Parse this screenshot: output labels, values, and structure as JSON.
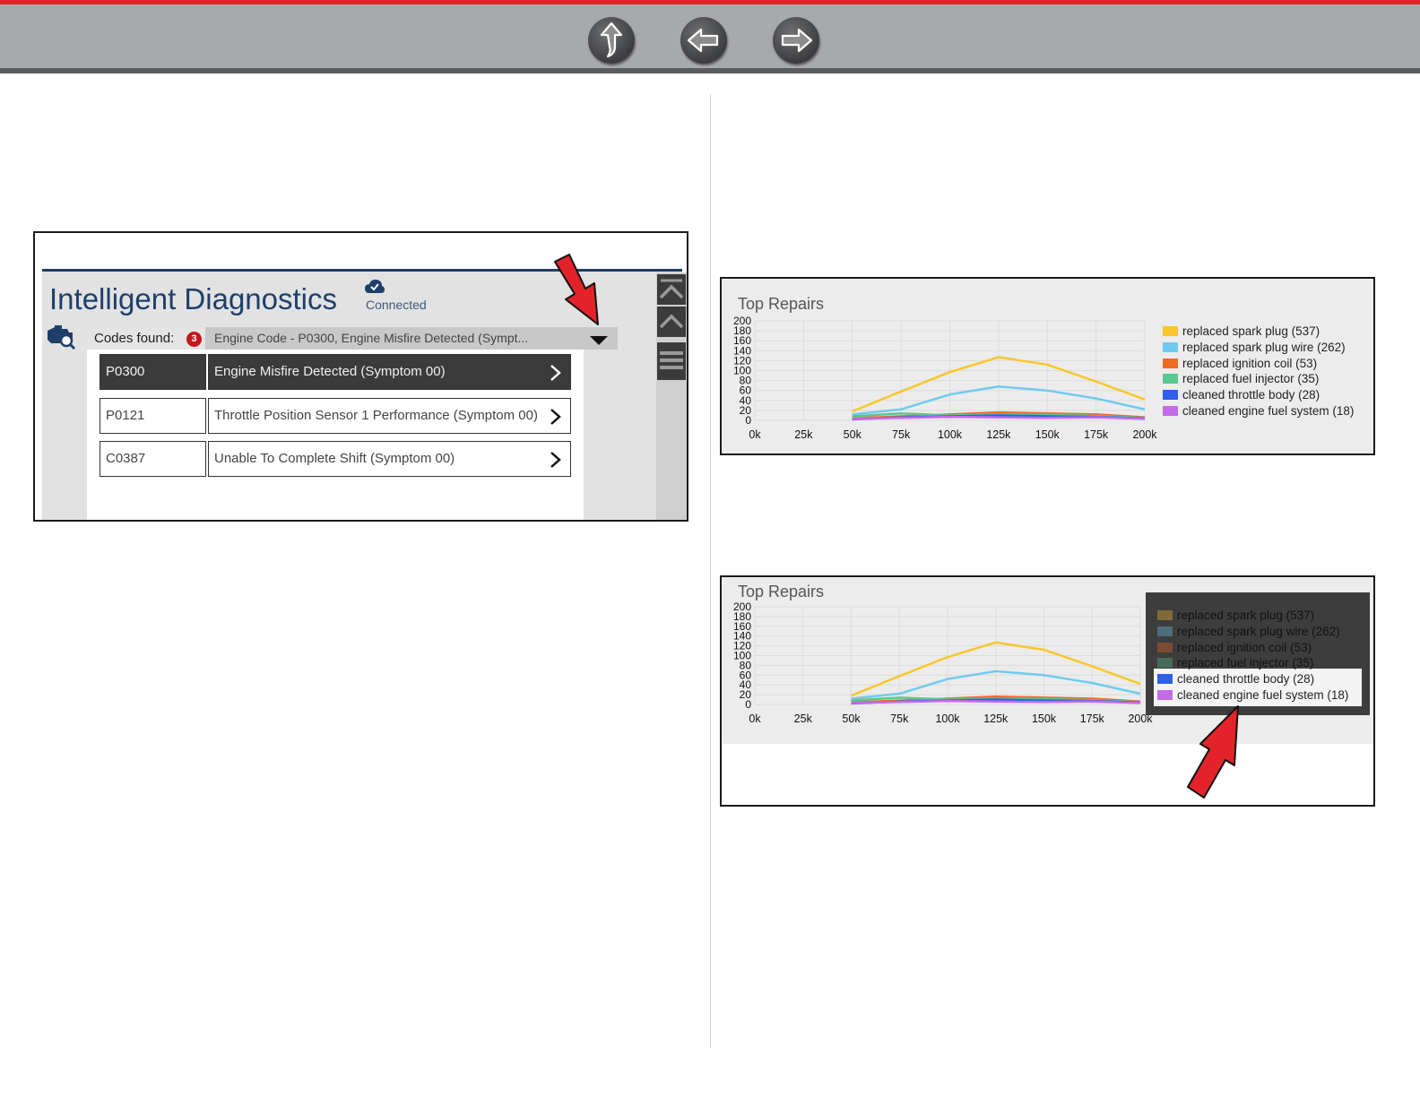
{
  "nav": {
    "buttons": [
      {
        "name": "up-arrow-icon",
        "label": "Up"
      },
      {
        "name": "back-arrow-icon",
        "label": "Back"
      },
      {
        "name": "forward-arrow-icon",
        "label": "Forward"
      }
    ],
    "accent_color": "#e2232a"
  },
  "diagnostics": {
    "title": "Intelligent Diagnostics",
    "status": "Connected",
    "codes_found_label": "Codes found:",
    "codes_found_count": "3",
    "selected_code_text": "Engine Code - P0300, Engine Misfire Detected (Sympt...",
    "codes": [
      {
        "code": "P0300",
        "description": "Engine Misfire Detected (Symptom 00)",
        "selected": true
      },
      {
        "code": "P0121",
        "description": "Throttle Position Sensor 1 Performance (Symptom 00)",
        "selected": false
      },
      {
        "code": "C0387",
        "description": "Unable To Complete Shift (Symptom 00)",
        "selected": false
      }
    ],
    "side_buttons": [
      "scroll-to-top-icon",
      "scroll-up-icon",
      "menu-icon"
    ]
  },
  "charts": {
    "top": {
      "highlighted_legend": []
    },
    "bottom": {
      "highlighted_legend": [
        "cleaned throttle body (28)",
        "cleaned engine fuel system (18)"
      ]
    }
  },
  "chart_data": [
    {
      "type": "line",
      "title": "Top Repairs",
      "x": [
        "0k",
        "25k",
        "50k",
        "75k",
        "100k",
        "125k",
        "150k",
        "175k",
        "200k"
      ],
      "x_values": [
        0,
        25,
        50,
        75,
        100,
        125,
        150,
        175,
        200
      ],
      "ylim": [
        0,
        200
      ],
      "yticks": [
        0,
        20,
        40,
        60,
        80,
        100,
        120,
        140,
        160,
        180,
        200
      ],
      "grid": true,
      "legend_position": "right",
      "series": [
        {
          "name": "replaced spark plug (537)",
          "color": "#f9c72a",
          "x": [
            50,
            75,
            100,
            125,
            150,
            175,
            200
          ],
          "values": [
            18,
            58,
            97,
            127,
            112,
            78,
            42
          ]
        },
        {
          "name": "replaced spark plug wire (262)",
          "color": "#6fcbef",
          "x": [
            50,
            75,
            100,
            125,
            150,
            175,
            200
          ],
          "values": [
            12,
            22,
            52,
            68,
            60,
            44,
            22
          ]
        },
        {
          "name": "replaced ignition coil (53)",
          "color": "#f06a23",
          "x": [
            50,
            75,
            100,
            125,
            150,
            175,
            200
          ],
          "values": [
            4,
            8,
            12,
            16,
            14,
            12,
            6
          ]
        },
        {
          "name": "replaced fuel injector (35)",
          "color": "#5ac78e",
          "x": [
            50,
            75,
            100,
            125,
            150,
            175,
            200
          ],
          "values": [
            8,
            14,
            10,
            12,
            11,
            9,
            5
          ]
        },
        {
          "name": "cleaned throttle body (28)",
          "color": "#2f5ee8",
          "x": [
            50,
            75,
            100,
            125,
            150,
            175,
            200
          ],
          "values": [
            2,
            6,
            8,
            10,
            8,
            7,
            4
          ]
        },
        {
          "name": "cleaned engine fuel system (18)",
          "color": "#c56be8",
          "x": [
            50,
            75,
            100,
            125,
            150,
            175,
            200
          ],
          "values": [
            3,
            5,
            7,
            6,
            5,
            6,
            3
          ]
        }
      ]
    },
    {
      "type": "line",
      "title": "Top Repairs",
      "x": [
        "0k",
        "25k",
        "50k",
        "75k",
        "100k",
        "125k",
        "150k",
        "175k",
        "200k"
      ],
      "x_values": [
        0,
        25,
        50,
        75,
        100,
        125,
        150,
        175,
        200
      ],
      "ylim": [
        0,
        200
      ],
      "yticks": [
        0,
        20,
        40,
        60,
        80,
        100,
        120,
        140,
        160,
        180,
        200
      ],
      "grid": true,
      "legend_position": "right",
      "series": [
        {
          "name": "replaced spark plug (537)",
          "color": "#f9c72a",
          "x": [
            50,
            75,
            100,
            125,
            150,
            175,
            200
          ],
          "values": [
            18,
            58,
            97,
            127,
            112,
            78,
            42
          ]
        },
        {
          "name": "replaced spark plug wire (262)",
          "color": "#6fcbef",
          "x": [
            50,
            75,
            100,
            125,
            150,
            175,
            200
          ],
          "values": [
            12,
            22,
            52,
            68,
            60,
            44,
            22
          ]
        },
        {
          "name": "replaced ignition coil (53)",
          "color": "#f06a23",
          "x": [
            50,
            75,
            100,
            125,
            150,
            175,
            200
          ],
          "values": [
            4,
            8,
            12,
            16,
            14,
            12,
            6
          ]
        },
        {
          "name": "replaced fuel injector (35)",
          "color": "#5ac78e",
          "x": [
            50,
            75,
            100,
            125,
            150,
            175,
            200
          ],
          "values": [
            8,
            14,
            10,
            12,
            11,
            9,
            5
          ]
        },
        {
          "name": "cleaned throttle body (28)",
          "color": "#2f5ee8",
          "x": [
            50,
            75,
            100,
            125,
            150,
            175,
            200
          ],
          "values": [
            2,
            6,
            8,
            10,
            8,
            7,
            4
          ]
        },
        {
          "name": "cleaned engine fuel system (18)",
          "color": "#c56be8",
          "x": [
            50,
            75,
            100,
            125,
            150,
            175,
            200
          ],
          "values": [
            3,
            5,
            7,
            6,
            5,
            6,
            3
          ]
        }
      ]
    }
  ]
}
